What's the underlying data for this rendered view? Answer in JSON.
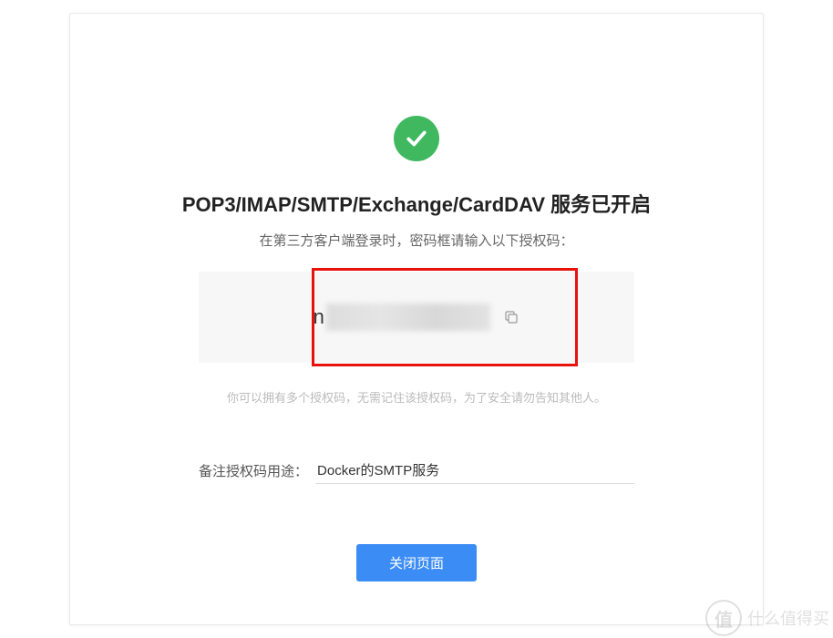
{
  "card": {
    "title": "POP3/IMAP/SMTP/Exchange/CardDAV 服务已开启",
    "subtitle": "在第三方客户端登录时，密码框请输入以下授权码：",
    "authCode": {
      "visiblePrefix": "n",
      "isRedacted": true
    },
    "hint": "你可以拥有多个授权码，无需记住该授权码，为了安全请勿告知其他人。",
    "remark": {
      "label": "备注授权码用途：",
      "value": "Docker的SMTP服务"
    },
    "closeButton": "关闭页面"
  },
  "watermark": {
    "symbol": "值",
    "text": "什么值得买"
  },
  "colors": {
    "success": "#40b860",
    "primary": "#3b8cf5",
    "highlight": "#e8120c"
  }
}
